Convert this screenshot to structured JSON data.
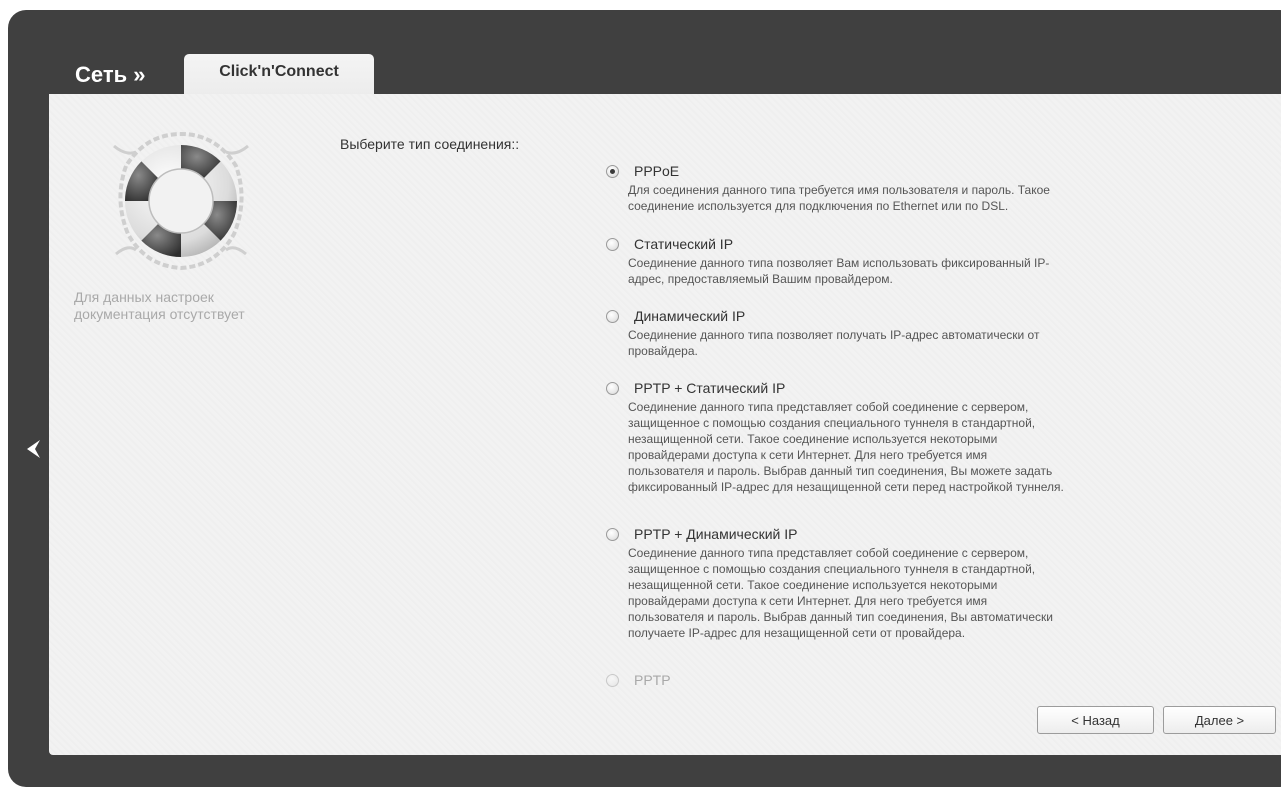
{
  "header": {
    "breadcrumb_root": "Сеть »",
    "active_tab": "Click'n'Connect"
  },
  "help": {
    "icon": "lifebuoy-icon",
    "text": "Для данных настроек документация отсутствует"
  },
  "form": {
    "label": "Выберите тип соединения::",
    "selected": "PPPoE",
    "options": [
      {
        "title": "PPPoE",
        "checked": true,
        "desc": "Для соединения данного типа требуется имя пользователя и пароль. Такое\nсоединение используется для подключения по Ethernet или по DSL."
      },
      {
        "title": "Статический IP",
        "checked": false,
        "desc": "Соединение данного типа позволяет Вам использовать фиксированный IP-\nадрес, предоставляемый Вашим провайдером."
      },
      {
        "title": "Динамический IP",
        "checked": false,
        "desc": "Соединение данного типа позволяет получать IP-адрес автоматически от\nпровайдера."
      },
      {
        "title": "PPTP + Статический IP",
        "checked": false,
        "desc": "Соединение данного типа представляет собой соединение с сервером,\nзащищенное с помощью создания специального туннеля в стандартной,\nнезащищенной сети. Такое соединение используется некоторыми\nпровайдерами доступа к сети Интернет. Для него требуется имя\nпользователя и пароль. Выбрав данный тип соединения, Вы можете задать\nфиксированный IP-адрес для незащищенной сети перед настройкой туннеля."
      },
      {
        "title": "PPTP + Динамический IP",
        "checked": false,
        "desc": "Соединение данного типа представляет собой соединение с сервером,\nзащищенное с помощью создания специального туннеля в стандартной,\nнезащищенной сети. Такое соединение используется некоторыми\nпровайдерами доступа к сети Интернет. Для него требуется имя\nпользователя и пароль. Выбрав данный тип соединения, Вы автоматически\nполучаете IP-адрес для незащищенной сети от провайдера."
      },
      {
        "title": "PPTP",
        "checked": false,
        "desc": ""
      }
    ]
  },
  "buttons": {
    "back": "< Назад",
    "next": "Далее >"
  },
  "nav": {
    "back_arrow_icon": "chevron-left-icon"
  },
  "colors": {
    "frame": "#404040",
    "panel": "#f2f2f2",
    "text": "#333333",
    "help_text": "#a9a9a9"
  }
}
